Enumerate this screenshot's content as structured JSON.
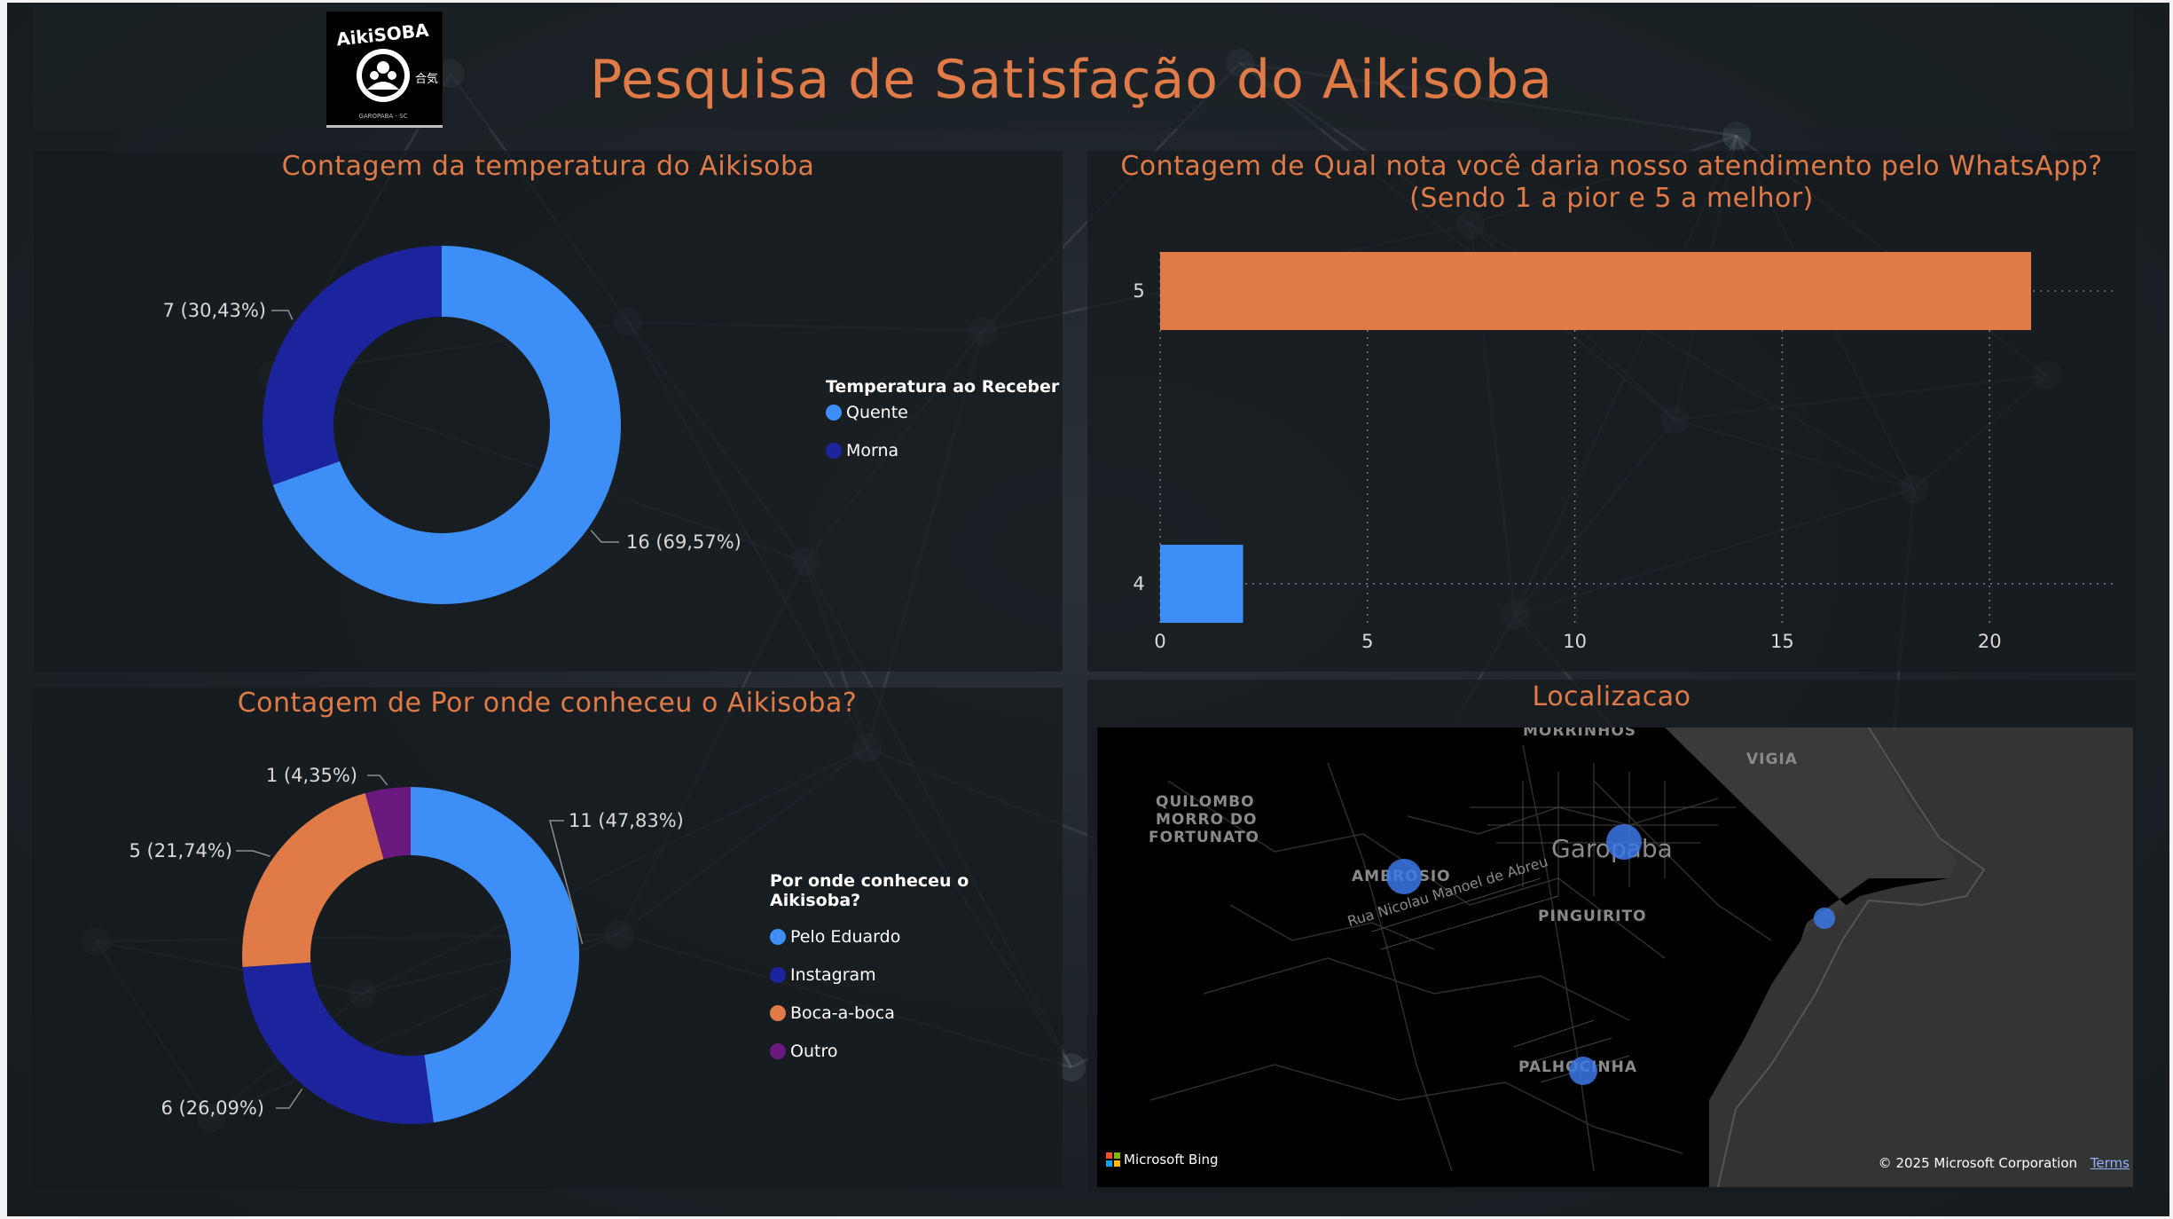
{
  "header": {
    "title": "Pesquisa de Satisfação do Aikisoba",
    "logo": {
      "text": "AikiSOBA",
      "subtext": "GAROPABA - SC",
      "side_glyph": "合気"
    }
  },
  "colors": {
    "accent": "#e07a46",
    "light_blue": "#3d8ef7",
    "dark_blue": "#1b249c",
    "orange": "#e07a46",
    "purple": "#6a1a7e"
  },
  "temperature_panel": {
    "title": "Contagem da temperatura do Aikisoba",
    "legend_title": "Temperatura ao Receber",
    "legend": [
      {
        "label": "Quente",
        "color": "#3d8ef7"
      },
      {
        "label": "Morna",
        "color": "#1b249c"
      }
    ]
  },
  "whatsapp_panel": {
    "title_line1": "Contagem de Qual nota você daria nosso atendimento pelo WhatsApp?",
    "title_line2": "(Sendo 1 a pior e 5 a melhor)"
  },
  "source_panel": {
    "title": "Contagem de Por onde conheceu o Aikisoba?",
    "legend_title": "Por onde conheceu o Aikisoba?",
    "legend": [
      {
        "label": "Pelo Eduardo",
        "color": "#3d8ef7"
      },
      {
        "label": "Instagram",
        "color": "#1b249c"
      },
      {
        "label": "Boca-a-boca",
        "color": "#e07a46"
      },
      {
        "label": "Outro",
        "color": "#6a1a7e"
      }
    ]
  },
  "map_panel": {
    "title": "Localizacao",
    "labels": {
      "morrinhos": "MORRINHOS",
      "vigia": "VIGIA",
      "quilombo1": "QUILOMBO",
      "quilombo2": "MORRO DO",
      "quilombo3": "FORTUNATO",
      "ambrosio": "AMBROSIO",
      "garopaba": "Garopaba",
      "pinguirito": "PINGUIRITO",
      "rua": "Rua Nicolau Manoel de Abreu",
      "palhocinha": "PALHOCINHA"
    },
    "attribution_bing": "Microsoft Bing",
    "copyright": "© 2025 Microsoft Corporation",
    "terms": "Terms"
  },
  "chart_data": [
    {
      "type": "pie",
      "variant": "donut",
      "title": "Contagem da temperatura do Aikisoba",
      "legend_title": "Temperatura ao Receber",
      "categories": [
        "Quente",
        "Morna"
      ],
      "values": [
        16,
        7
      ],
      "labels": [
        "16 (69,57%)",
        "7 (30,43%)"
      ],
      "colors": [
        "#3d8ef7",
        "#1b249c"
      ],
      "legend_position": "right"
    },
    {
      "type": "bar",
      "orientation": "horizontal",
      "title": "Contagem de Qual nota você daria nosso atendimento pelo WhatsApp? (Sendo 1 a pior e 5 a melhor)",
      "categories": [
        "5",
        "4"
      ],
      "values": [
        21,
        2
      ],
      "colors": [
        "#e07a46",
        "#3d8ef7"
      ],
      "xticks": [
        "0",
        "5",
        "10",
        "15",
        "20"
      ],
      "xlim": [
        0,
        22
      ],
      "grid": true
    },
    {
      "type": "pie",
      "variant": "donut",
      "title": "Contagem de Por onde conheceu o Aikisoba?",
      "legend_title": "Por onde conheceu o Aikisoba?",
      "categories": [
        "Pelo Eduardo",
        "Instagram",
        "Boca-a-boca",
        "Outro"
      ],
      "values": [
        11,
        6,
        5,
        1
      ],
      "labels": [
        "11 (47,83%)",
        "6 (26,09%)",
        "5 (21,74%)",
        "1 (4,35%)"
      ],
      "colors": [
        "#3d8ef7",
        "#1b249c",
        "#e07a46",
        "#6a1a7e"
      ],
      "legend_position": "right"
    }
  ]
}
